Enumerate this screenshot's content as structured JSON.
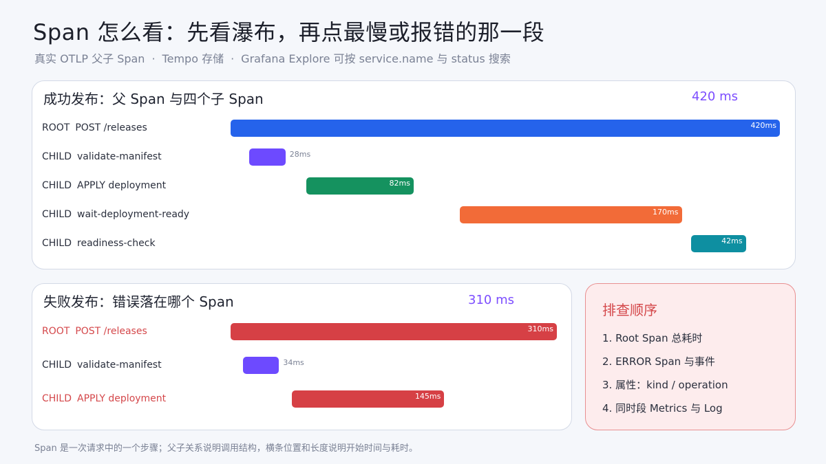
{
  "header": {
    "title": "Span 怎么看：先看瀑布，再点最慢或报错的那一段",
    "subtitle_parts": [
      "真实 OTLP 父子 Span",
      "Tempo 存储",
      "Grafana Explore 可按 service.name 与 status 搜索"
    ],
    "separator": "·"
  },
  "success_panel": {
    "title": "成功发布：父 Span 与四个子 Span",
    "total": "420 ms",
    "rows": [
      {
        "kind": "ROOT",
        "name": "POST /releases",
        "start": 0,
        "duration": 420,
        "duration_label": "420ms",
        "color": "#2563eb",
        "label_inside": true
      },
      {
        "kind": "CHILD",
        "name": "validate-manifest",
        "start": 14,
        "duration": 28,
        "duration_label": "28ms",
        "color": "#6d4aff",
        "label_inside": false
      },
      {
        "kind": "CHILD",
        "name": "APPLY deployment",
        "start": 58,
        "duration": 82,
        "duration_label": "82ms",
        "color": "#15925f",
        "label_inside": true
      },
      {
        "kind": "CHILD",
        "name": "wait-deployment-ready",
        "start": 175,
        "duration": 170,
        "duration_label": "170ms",
        "color": "#f26b38",
        "label_inside": true
      },
      {
        "kind": "CHILD",
        "name": "readiness-check",
        "start": 352,
        "duration": 42,
        "duration_label": "42ms",
        "color": "#0e8fa1",
        "label_inside": true
      }
    ]
  },
  "failure_panel": {
    "title": "失败发布：错误落在哪个 Span",
    "total": "310 ms",
    "rows": [
      {
        "kind": "ROOT",
        "name": "POST /releases",
        "start": 0,
        "duration": 310,
        "duration_label": "310ms",
        "color": "#d64045",
        "label_inside": true,
        "error": true
      },
      {
        "kind": "CHILD",
        "name": "validate-manifest",
        "start": 12,
        "duration": 34,
        "duration_label": "34ms",
        "color": "#6d4aff",
        "label_inside": false,
        "error": false
      },
      {
        "kind": "CHILD",
        "name": "APPLY deployment",
        "start": 58,
        "duration": 145,
        "duration_label": "145ms",
        "color": "#d64045",
        "label_inside": true,
        "error": true
      }
    ]
  },
  "troubleshoot": {
    "title": "排查顺序",
    "items": [
      "1. Root Span 总耗时",
      "2. ERROR Span 与事件",
      "3. 属性：kind / operation",
      "4. 同时段 Metrics 与 Log"
    ]
  },
  "footer": "Span 是一次请求中的一个步骤；父子关系说明调用结构，横条位置和长度说明开始时间与耗时。"
}
